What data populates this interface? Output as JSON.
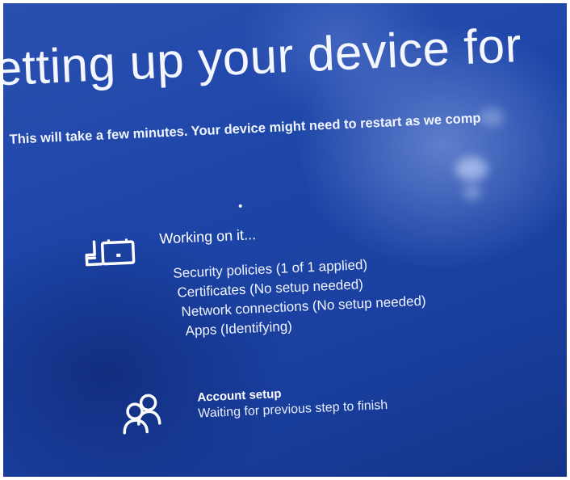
{
  "screen": {
    "title": "etting up your device for",
    "subtitle": "This will take a few minutes. Your device might need to restart as we comp"
  },
  "device_preparation": {
    "icon": "device-setup-icon",
    "status": "Working on it...",
    "steps": [
      "Security policies (1 of 1 applied)",
      "Certificates (No setup needed)",
      "Network connections (No setup needed)",
      "Apps (Identifying)"
    ]
  },
  "account_setup": {
    "icon": "people-icon",
    "title": "Account setup",
    "status": "Waiting for previous step to finish"
  },
  "colors": {
    "background": "#1d45a8",
    "text": "#ffffff"
  }
}
